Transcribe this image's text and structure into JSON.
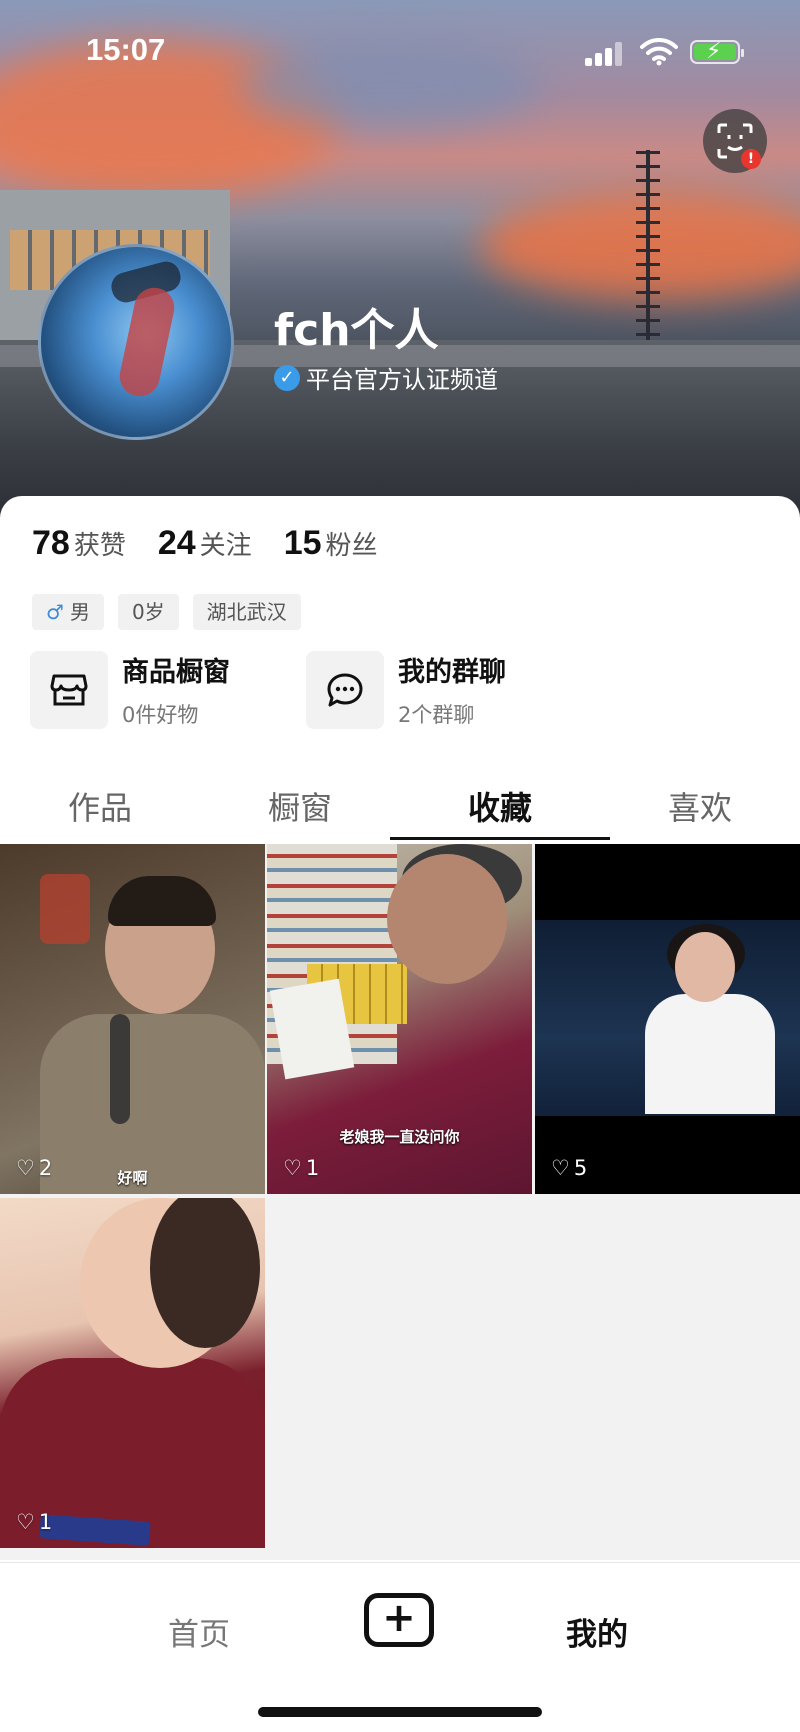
{
  "status": {
    "time": "15:07"
  },
  "profile": {
    "username": "fch个人",
    "verified_text": "平台官方认证频道",
    "stats": [
      {
        "num": "78",
        "label": "获赞"
      },
      {
        "num": "24",
        "label": "关注"
      },
      {
        "num": "15",
        "label": "粉丝"
      }
    ],
    "tags": {
      "gender_symbol": "♂",
      "gender": "男",
      "age": "0岁",
      "location": "湖北武汉"
    }
  },
  "features": [
    {
      "title": "商品橱窗",
      "sub": "0件好物",
      "icon": "shop-icon"
    },
    {
      "title": "我的群聊",
      "sub": "2个群聊",
      "icon": "chat-icon"
    }
  ],
  "tabs": [
    "作品",
    "橱窗",
    "收藏",
    "喜欢"
  ],
  "active_tab": "收藏",
  "videos": [
    {
      "likes": "2",
      "caption": "好啊"
    },
    {
      "likes": "1",
      "caption": "老娘我一直没问你"
    },
    {
      "likes": "5",
      "caption": ""
    },
    {
      "likes": "1",
      "caption": ""
    }
  ],
  "nav": {
    "home": "首页",
    "add": "+",
    "me": "我的"
  },
  "colors": {
    "verify_blue": "#3a9be8",
    "notification_red": "#e8352d",
    "battery_green": "#5cd04f"
  }
}
